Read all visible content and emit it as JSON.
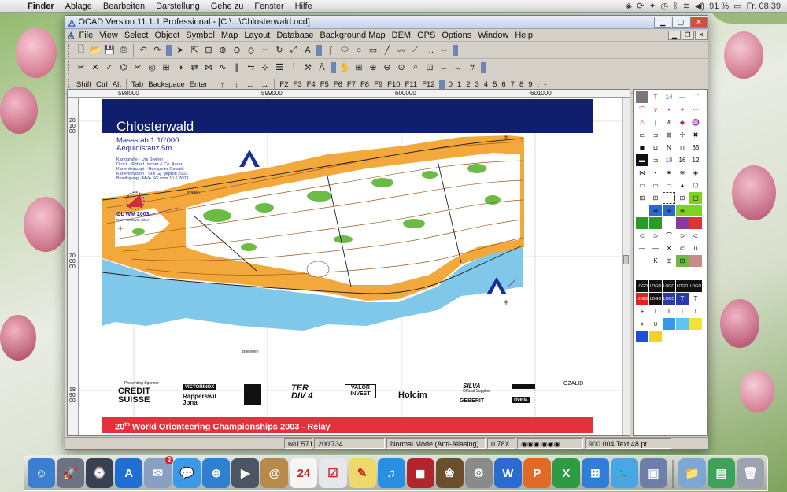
{
  "menubar": {
    "app_name": "Finder",
    "items": [
      "Ablage",
      "Bearbeiten",
      "Darstellung",
      "Gehe zu",
      "Fenster",
      "Hilfe"
    ],
    "battery": "91 %",
    "clock": "Fr. 08:39"
  },
  "window": {
    "title": "OCAD Version 11.1.1  Professional - [C:\\...\\Chlosterwald.ocd]",
    "menu": [
      "File",
      "View",
      "Select",
      "Object",
      "Symbol",
      "Map",
      "Layout",
      "Database",
      "Background Map",
      "DEM",
      "GPS",
      "Options",
      "Window",
      "Help"
    ],
    "keys_left": [
      "Shift",
      "Ctrl",
      "Alt",
      "Tab",
      "Backspace",
      "Enter"
    ],
    "keys_f": [
      "F2",
      "F3",
      "F4",
      "F5",
      "F6",
      "F7",
      "F8",
      "F9",
      "F10",
      "F11",
      "F12"
    ],
    "keys_num": [
      "0",
      "1",
      "2",
      "3",
      "4",
      "5",
      "6",
      "7",
      "8",
      "9",
      ".",
      "-"
    ]
  },
  "ruler": {
    "top": [
      "598000",
      "599000",
      "600000",
      "601000"
    ],
    "left": [
      "201000",
      "200000",
      "199000"
    ]
  },
  "map": {
    "title": "Chlosterwald",
    "scale": "Massstab 1:10'000",
    "contour": "Aequidistanz 5m",
    "credits": [
      [
        "Kartografie",
        "Urs Steiner"
      ],
      [
        "Druck",
        "Peter Lüscher & Co. Aarau"
      ],
      [
        "Kartenkonzept",
        "Hanspeter Oswald"
      ],
      [
        "Kartenrevision",
        "SOI Gj. geprüft 2003"
      ],
      [
        "Bewilligung",
        "MVA SG vom 10.6.2003"
      ]
    ],
    "event_logo": "OL WM 2003",
    "event_logo_sub": "RAPPERSWIL JONA",
    "place_labels": [
      "Wagen",
      "Bollingen"
    ],
    "presenting_sponsor": "Presenting Sponsor",
    "sponsors": [
      "CREDIT SUISSE",
      "VICTORINOX",
      "Rapperswil Jona",
      "TER DIV 4",
      "VALOR INVEST",
      "Holcim",
      "SILVA",
      "GEBERIT",
      "rivella",
      "OZALID"
    ],
    "official_supplier": "Official Supplier",
    "footer": "World Orienteering Championships 2003 - Relay",
    "footer_ordinal": "20",
    "footer_ordinal_sup": "th"
  },
  "status": {
    "coords_x": "601'571",
    "coords_y": "200'734",
    "mode": "Normal Mode (Anti-Aliasing)",
    "zoom": "0.78X",
    "symbol": "900.004 Text 48 pt"
  },
  "dock": {
    "apps": [
      {
        "name": "finder-icon",
        "color": "#3a7fd1",
        "glyph": "☺"
      },
      {
        "name": "launchpad-icon",
        "color": "#6b7280",
        "glyph": "🚀"
      },
      {
        "name": "dashboard-icon",
        "color": "#374151",
        "glyph": "⌚"
      },
      {
        "name": "app-store-icon",
        "color": "#1d6fd6",
        "glyph": "A"
      },
      {
        "name": "mail-icon",
        "color": "#8a9fc4",
        "glyph": "✉",
        "badge": "2"
      },
      {
        "name": "messages-icon",
        "color": "#3b9ae8",
        "glyph": "💬"
      },
      {
        "name": "safari-icon",
        "color": "#2f80d1",
        "glyph": "⊕"
      },
      {
        "name": "facetime-icon",
        "color": "#4b5563",
        "glyph": "▶"
      },
      {
        "name": "contacts-icon",
        "color": "#b68a4a",
        "glyph": "@"
      },
      {
        "name": "calendar-icon",
        "color": "#f5f5f5",
        "glyph": "24"
      },
      {
        "name": "reminders-icon",
        "color": "#e5e7eb",
        "glyph": "☑"
      },
      {
        "name": "notes-icon",
        "color": "#f0d96b",
        "glyph": "✎"
      },
      {
        "name": "itunes-icon",
        "color": "#2a8fe0",
        "glyph": "♫"
      },
      {
        "name": "photo-booth-icon",
        "color": "#b0262c",
        "glyph": "◼"
      },
      {
        "name": "iphoto-icon",
        "color": "#6b4f2c",
        "glyph": "❀"
      },
      {
        "name": "system-preferences-icon",
        "color": "#8a8a8a",
        "glyph": "⚙"
      },
      {
        "name": "word-icon",
        "color": "#2a6bd1",
        "glyph": "W"
      },
      {
        "name": "powerpoint-icon",
        "color": "#e06a26",
        "glyph": "P"
      },
      {
        "name": "excel-icon",
        "color": "#2e9a41",
        "glyph": "X"
      },
      {
        "name": "windows-icon",
        "color": "#2f7ed8",
        "glyph": "⊞"
      },
      {
        "name": "twitter-icon",
        "color": "#48a6e6",
        "glyph": "🐦"
      },
      {
        "name": "virtualbox-icon",
        "color": "#6d7fa8",
        "glyph": "▣"
      },
      {
        "name": "documents-icon",
        "color": "#7fa7d6",
        "glyph": "📁"
      },
      {
        "name": "downloads-icon",
        "color": "#3ea35a",
        "glyph": "▤"
      },
      {
        "name": "trash-icon",
        "color": "#9ca3af",
        "glyph": "🗑"
      }
    ]
  }
}
